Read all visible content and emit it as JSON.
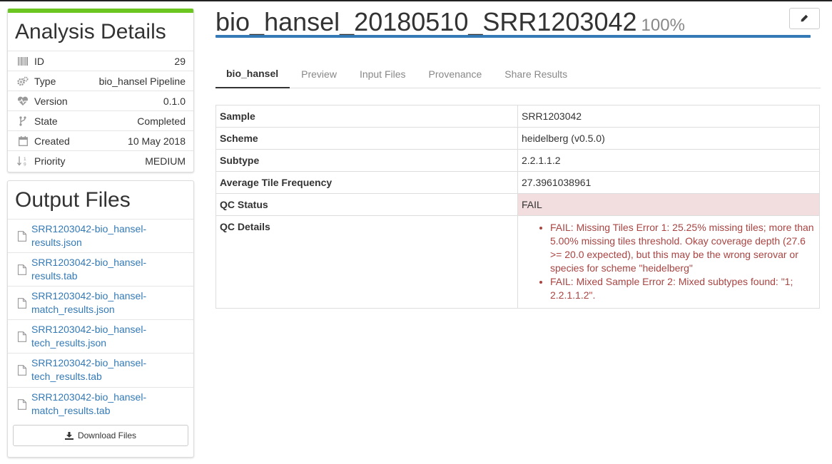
{
  "colors": {
    "progress": "#6bc71f",
    "title_bar": "#337ab7",
    "link": "#337ab7",
    "fail_bg": "#f2dede",
    "fail_text": "#a94442"
  },
  "analysis_details": {
    "heading": "Analysis Details",
    "progress_percent": 100,
    "rows": [
      {
        "icon": "barcode-icon",
        "label": "ID",
        "value": "29"
      },
      {
        "icon": "cogs-icon",
        "label": "Type",
        "value": "bio_hansel Pipeline"
      },
      {
        "icon": "heartbeat-icon",
        "label": "Version",
        "value": "0.1.0"
      },
      {
        "icon": "code-fork-icon",
        "label": "State",
        "value": "Completed"
      },
      {
        "icon": "calendar-icon",
        "label": "Created",
        "value": "10 May 2018"
      },
      {
        "icon": "sort-numeric-icon",
        "label": "Priority",
        "value": "MEDIUM"
      }
    ]
  },
  "output_files": {
    "heading": "Output Files",
    "files": [
      {
        "line1": "SRR1203042-bio_hansel-",
        "line2": "results.json"
      },
      {
        "line1": "SRR1203042-bio_hansel-",
        "line2": "results.tab"
      },
      {
        "line1": "SRR1203042-bio_hansel-",
        "line2": "match_results.json"
      },
      {
        "line1": "SRR1203042-bio_hansel-",
        "line2": "tech_results.json"
      },
      {
        "line1": "SRR1203042-bio_hansel-",
        "line2": "tech_results.tab"
      },
      {
        "line1": "SRR1203042-bio_hansel-",
        "line2": "match_results.tab"
      }
    ],
    "download_label": "Download Files"
  },
  "header": {
    "title": "bio_hansel_20180510_SRR1203042",
    "percent": "100%",
    "edit_icon": "pencil-icon"
  },
  "tabs": [
    {
      "label": "bio_hansel",
      "active": true
    },
    {
      "label": "Preview",
      "active": false
    },
    {
      "label": "Input Files",
      "active": false
    },
    {
      "label": "Provenance",
      "active": false
    },
    {
      "label": "Share Results",
      "active": false
    }
  ],
  "results": {
    "rows": [
      {
        "key": "Sample",
        "value": "SRR1203042"
      },
      {
        "key": "Scheme",
        "value": "heidelberg (v0.5.0)"
      },
      {
        "key": "Subtype",
        "value": "2.2.1.1.2"
      },
      {
        "key": "Average Tile Frequency",
        "value": "27.3961038961"
      },
      {
        "key": "QC Status",
        "value": "FAIL"
      }
    ],
    "qc_details_key": "QC Details",
    "qc_details": [
      "FAIL: Missing Tiles Error 1: 25.25% missing tiles; more than 5.00% missing tiles threshold. Okay coverage depth (27.6 >= 20.0 expected), but this may be the wrong serovar or species for scheme \"heidelberg\"",
      "FAIL: Mixed Sample Error 2: Mixed subtypes found: \"1; 2.2.1.1.2\"."
    ]
  }
}
